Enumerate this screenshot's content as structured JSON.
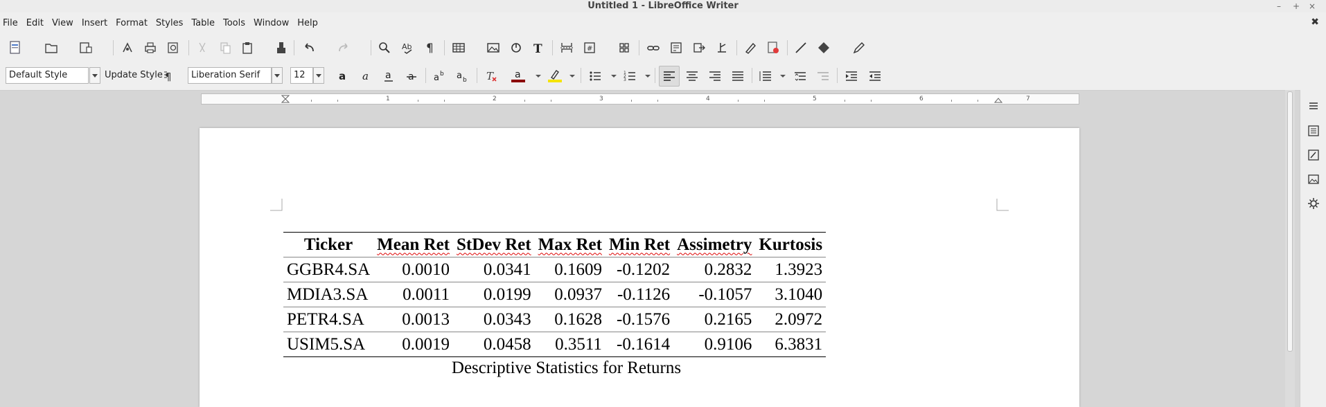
{
  "window": {
    "title": "Untitled 1 - LibreOffice Writer",
    "minimize": "–",
    "maximize": "+",
    "close": "×",
    "doc_close": "✖"
  },
  "menubar": {
    "items": [
      "File",
      "Edit",
      "View",
      "Insert",
      "Format",
      "Styles",
      "Table",
      "Tools",
      "Window",
      "Help"
    ]
  },
  "format_bar": {
    "paragraph_style": "Default Style",
    "update_style_label": "Update Style",
    "font_name": "Liberation Serif",
    "font_size": "12"
  },
  "ruler": {
    "numbers": [
      "1",
      "2",
      "3",
      "4",
      "5",
      "6",
      "7"
    ]
  },
  "colors": {
    "font_color": "#8b0000",
    "highlight_color": "#f5e400",
    "spelling_squiggle": "#dd0000"
  },
  "document": {
    "table": {
      "headers": [
        "Ticker",
        "Mean Ret",
        "StDev Ret",
        "Max Ret",
        "Min Ret",
        "Assimetry",
        "Kurtosis"
      ],
      "rows": [
        [
          "GGBR4.SA",
          "0.0010",
          "0.0341",
          "0.1609",
          "-0.1202",
          "0.2832",
          "1.3923"
        ],
        [
          "MDIA3.SA",
          "0.0011",
          "0.0199",
          "0.0937",
          "-0.1126",
          "-0.1057",
          "3.1040"
        ],
        [
          "PETR4.SA",
          "0.0013",
          "0.0343",
          "0.1628",
          "-0.1576",
          "0.2165",
          "2.0972"
        ],
        [
          "USIM5.SA",
          "0.0019",
          "0.0458",
          "0.3511",
          "-0.1614",
          "0.9106",
          "6.3831"
        ]
      ]
    },
    "caption": "Descriptive Statistics for Returns"
  }
}
